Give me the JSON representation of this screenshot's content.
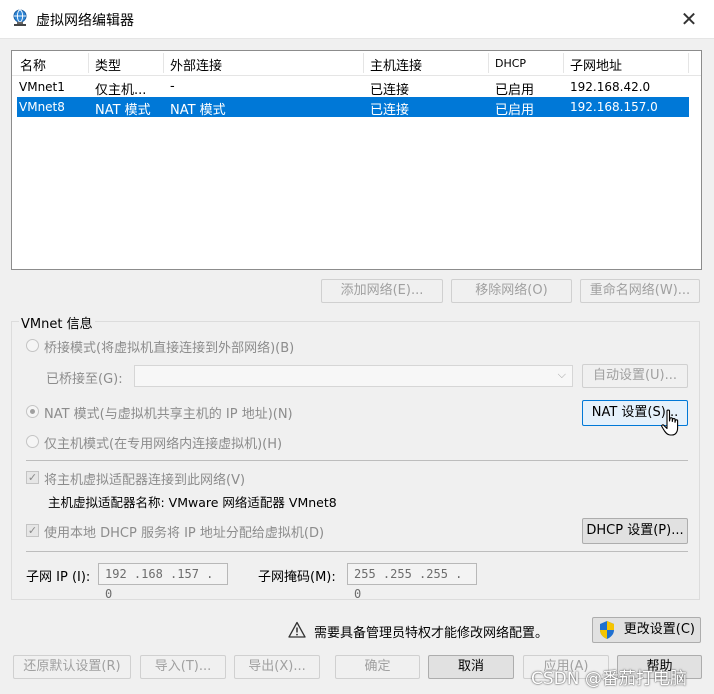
{
  "window": {
    "title": "虚拟网络编辑器",
    "close_glyph": "✕"
  },
  "table": {
    "headers": [
      "名称",
      "类型",
      "外部连接",
      "主机连接",
      "DHCP",
      "子网地址"
    ],
    "rows": [
      {
        "name": "VMnet1",
        "type": "仅主机...",
        "external": "-",
        "host": "已连接",
        "dhcp": "已启用",
        "subnet": "192.168.42.0"
      },
      {
        "name": "VMnet8",
        "type": "NAT 模式",
        "external": "NAT 模式",
        "host": "已连接",
        "dhcp": "已启用",
        "subnet": "192.168.157.0"
      }
    ]
  },
  "list_buttons": {
    "add": "添加网络(E)...",
    "remove": "移除网络(O)",
    "rename": "重命名网络(W)..."
  },
  "info": {
    "group_title": "VMnet 信息",
    "bridged_label": "桥接模式(将虚拟机直接连接到外部网络)(B)",
    "bridged_to_label": "已桥接至(G):",
    "bridged_to_value": "",
    "auto_settings": "自动设置(U)...",
    "nat_label": "NAT 模式(与虚拟机共享主机的 IP 地址)(N)",
    "nat_settings": "NAT 设置(S)...",
    "hostonly_label": "仅主机模式(在专用网络内连接虚拟机)(H)",
    "connect_adapter_label": "将主机虚拟适配器连接到此网络(V)",
    "adapter_name_label": "主机虚拟适配器名称: VMware 网络适配器 VMnet8",
    "dhcp_label": "使用本地 DHCP 服务将 IP 地址分配给虚拟机(D)",
    "dhcp_settings": "DHCP 设置(P)...",
    "subnet_ip_label": "子网 IP (I):",
    "subnet_ip_value": "192 .168 .157 .  0",
    "subnet_mask_label": "子网掩码(M):",
    "subnet_mask_value": "255 .255 .255 .  0",
    "check_glyph": "✓",
    "dropdown_glyph": "⌵"
  },
  "admin": {
    "notice": "需要具备管理员特权才能修改网络配置。",
    "change_settings": "更改设置(C)"
  },
  "footer": {
    "restore": "还原默认设置(R)",
    "import": "导入(T)...",
    "export": "导出(X)...",
    "ok": "确定",
    "cancel": "取消",
    "apply": "应用(A)",
    "help": "帮助"
  },
  "watermark": "CSDN @番茄打电脑",
  "colors": {
    "selection": "#0078d7",
    "window_bg": "#f0f0f0"
  }
}
